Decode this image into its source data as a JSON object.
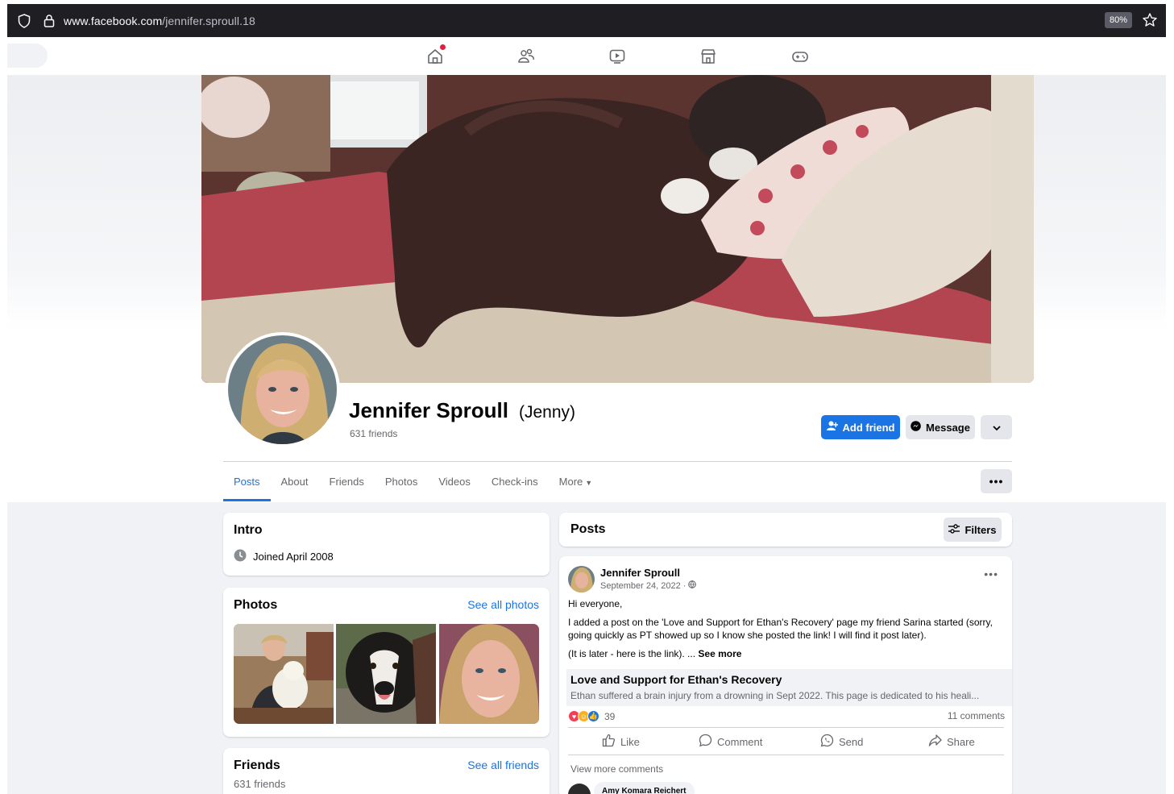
{
  "browser": {
    "url_host": "www.facebook.com",
    "url_path": "/jennifer.sproull.18",
    "zoom": "80%"
  },
  "nav": {
    "icons": [
      "home-icon",
      "friends-icon",
      "watch-icon",
      "marketplace-icon",
      "gaming-icon"
    ]
  },
  "profile": {
    "name": "Jennifer Sproull",
    "nickname": "(Jenny)",
    "friend_count": "631 friends",
    "add_friend_label": "Add friend",
    "message_label": "Message"
  },
  "tabs": [
    {
      "label": "Posts",
      "active": true
    },
    {
      "label": "About"
    },
    {
      "label": "Friends"
    },
    {
      "label": "Photos"
    },
    {
      "label": "Videos"
    },
    {
      "label": "Check-ins"
    },
    {
      "label": "More"
    }
  ],
  "intro": {
    "title": "Intro",
    "joined": "Joined April 2008"
  },
  "photos": {
    "title": "Photos",
    "see_all": "See all photos"
  },
  "friends": {
    "title": "Friends",
    "see_all": "See all friends",
    "count": "631 friends"
  },
  "posts": {
    "title": "Posts",
    "filters_label": "Filters"
  },
  "post": {
    "author": "Jennifer Sproull",
    "date": "September 24, 2022 ·",
    "greeting": "Hi everyone,",
    "body": "I added a post on the 'Love and Support for Ethan's Recovery' page my friend Sarina started (sorry, going quickly as PT showed up so I know she posted the link! I will find it post later).",
    "later": "(It is later - here is the link). ...",
    "see_more": "See more",
    "link_title": "Love and Support for Ethan's Recovery",
    "link_desc": "Ethan suffered a brain injury from a drowning in Sept 2022. This page is dedicated to his heali...",
    "reaction_count": "39",
    "comment_count": "11 comments",
    "actions": {
      "like": "Like",
      "comment": "Comment",
      "send": "Send",
      "share": "Share"
    },
    "view_more": "View more comments",
    "commenter": "Amy Komara Reichert"
  },
  "colors": {
    "accent": "#1b74e4",
    "background": "#f0f2f5",
    "secondary_text": "#65676b"
  }
}
